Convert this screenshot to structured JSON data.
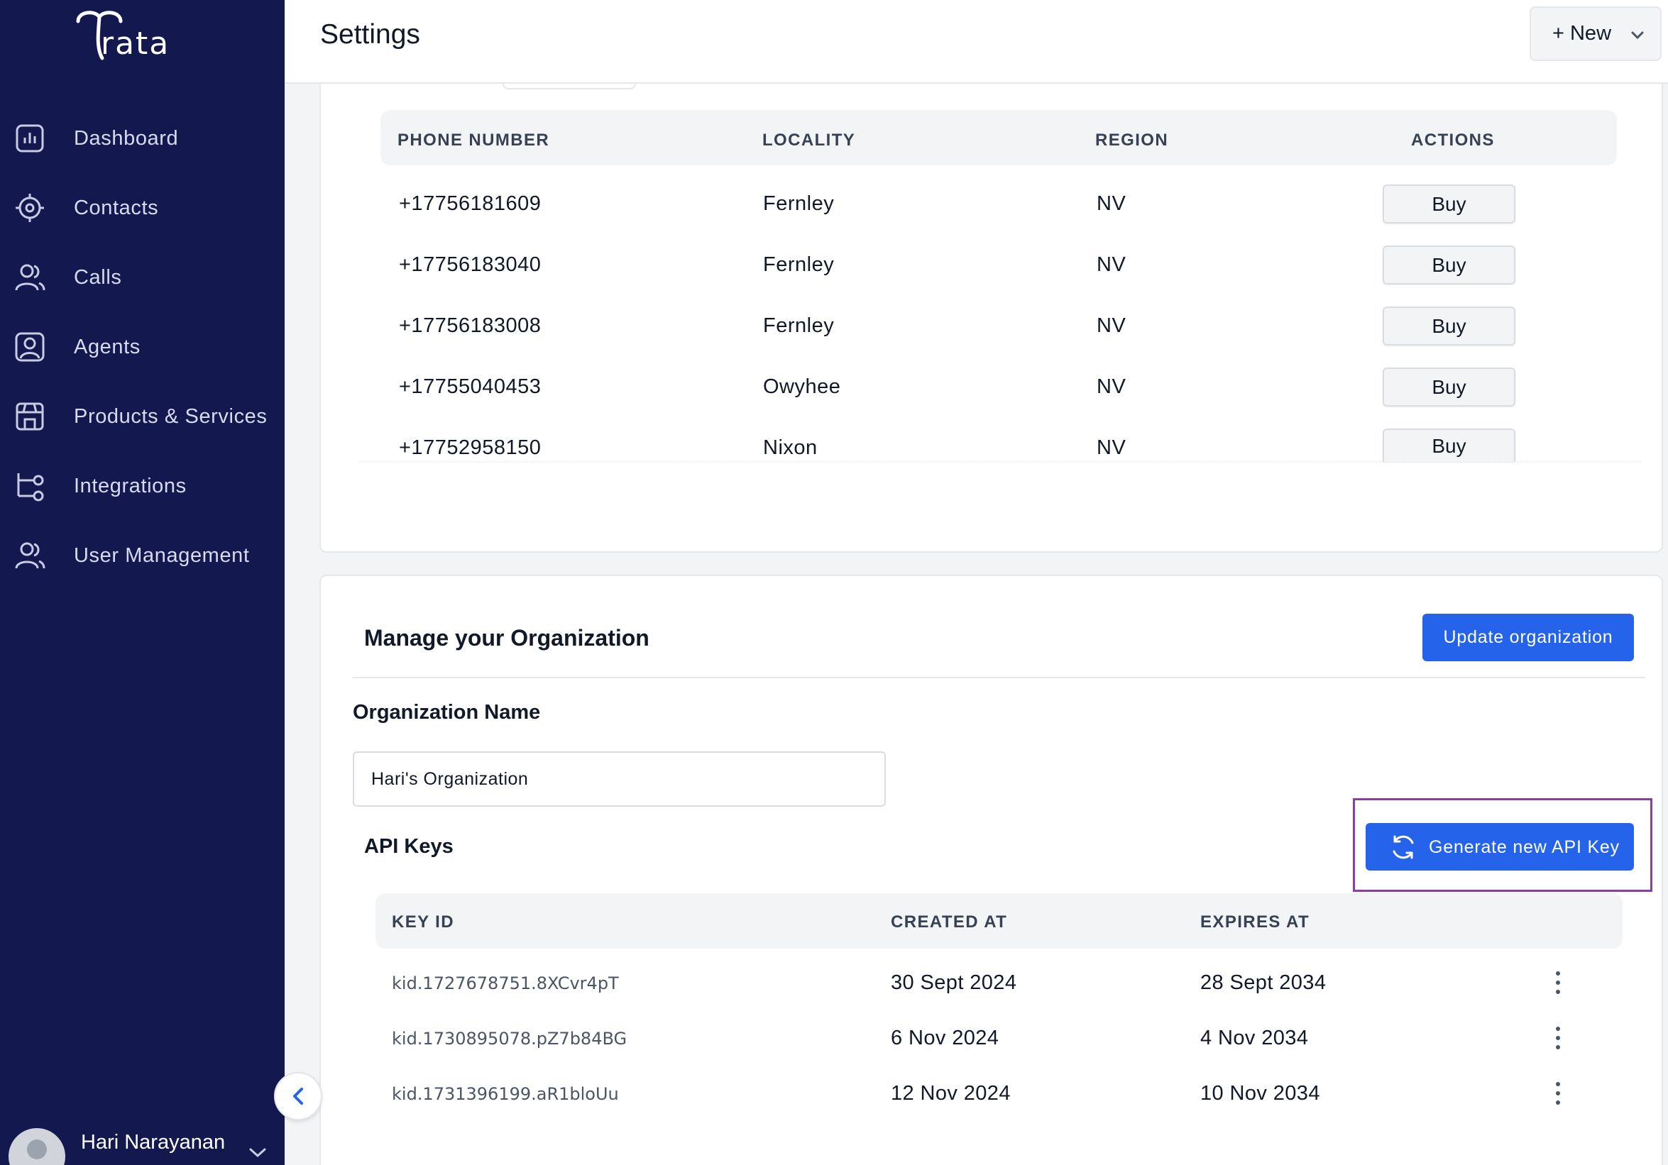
{
  "app": {
    "logo_text": "rata"
  },
  "sidebar": {
    "items": [
      {
        "label": "Dashboard",
        "icon": "chart-icon"
      },
      {
        "label": "Contacts",
        "icon": "target-icon"
      },
      {
        "label": "Calls",
        "icon": "users-icon"
      },
      {
        "label": "Agents",
        "icon": "agent-icon"
      },
      {
        "label": "Products & Services",
        "icon": "store-icon"
      },
      {
        "label": "Integrations",
        "icon": "integrations-icon"
      },
      {
        "label": "User Management",
        "icon": "user-management-icon"
      }
    ],
    "user": {
      "name": "Hari Narayanan"
    }
  },
  "header": {
    "title": "Settings",
    "new_label": "+ New"
  },
  "phone_table": {
    "columns": [
      "PHONE NUMBER",
      "LOCALITY",
      "REGION",
      "ACTIONS"
    ],
    "rows": [
      {
        "phone": "+17756181609",
        "locality": "Fernley",
        "region": "NV",
        "action": "Buy"
      },
      {
        "phone": "+17756183040",
        "locality": "Fernley",
        "region": "NV",
        "action": "Buy"
      },
      {
        "phone": "+17756183008",
        "locality": "Fernley",
        "region": "NV",
        "action": "Buy"
      },
      {
        "phone": "+17755040453",
        "locality": "Owyhee",
        "region": "NV",
        "action": "Buy"
      },
      {
        "phone": "+17752958150",
        "locality": "Nixon",
        "region": "NV",
        "action": "Buy"
      }
    ]
  },
  "organization": {
    "title": "Manage your Organization",
    "update_label": "Update organization",
    "name_label": "Organization Name",
    "name_value": "Hari's Organization"
  },
  "api_keys": {
    "label": "API Keys",
    "generate_label": "Generate new API Key",
    "columns": [
      "KEY ID",
      "CREATED AT",
      "EXPIRES AT"
    ],
    "rows": [
      {
        "key_id": "kid.1727678751.8XCvr4pT",
        "created": "30 Sept 2024",
        "expires": "28 Sept 2034"
      },
      {
        "key_id": "kid.1730895078.pZ7b84BG",
        "created": "6 Nov 2024",
        "expires": "4 Nov 2034"
      },
      {
        "key_id": "kid.1731396199.aR1bloUu",
        "created": "12 Nov 2024",
        "expires": "10 Nov 2034"
      }
    ]
  },
  "colors": {
    "sidebar_bg": "#13194f",
    "primary": "#2563eb",
    "highlight": "#8b3fa0"
  }
}
